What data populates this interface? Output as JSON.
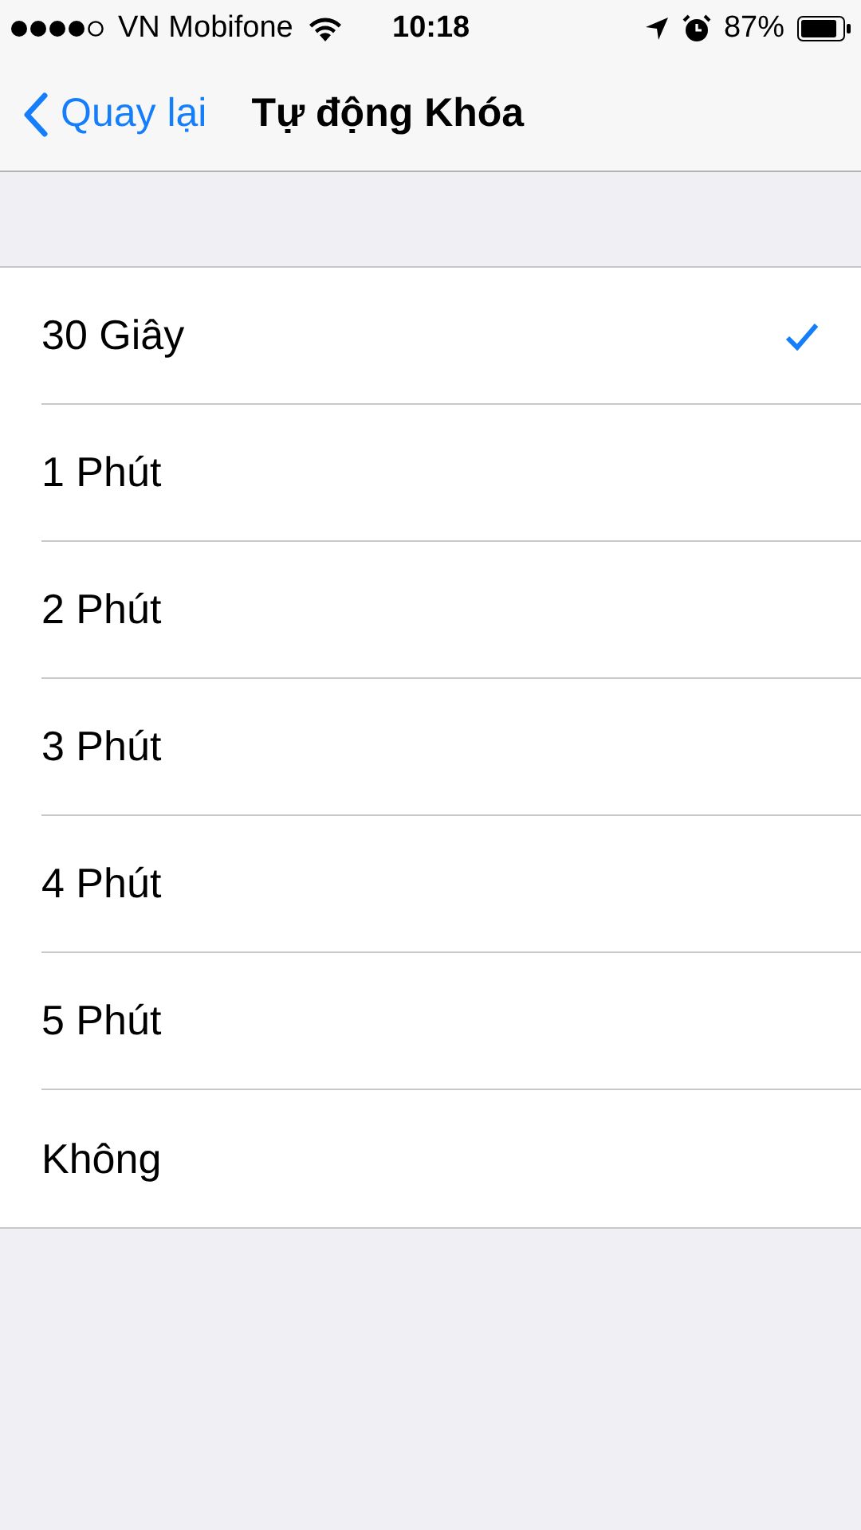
{
  "status_bar": {
    "carrier": "VN Mobifone",
    "time": "10:18",
    "battery": "87%"
  },
  "nav_bar": {
    "back": "Quay lại",
    "title": "Tự động Khóa"
  },
  "options": [
    {
      "label": "30 Giây",
      "selected": true
    },
    {
      "label": "1 Phút",
      "selected": false
    },
    {
      "label": "2 Phút",
      "selected": false
    },
    {
      "label": "3 Phút",
      "selected": false
    },
    {
      "label": "4 Phút",
      "selected": false
    },
    {
      "label": "5 Phút",
      "selected": false
    },
    {
      "label": "Không",
      "selected": false
    }
  ]
}
